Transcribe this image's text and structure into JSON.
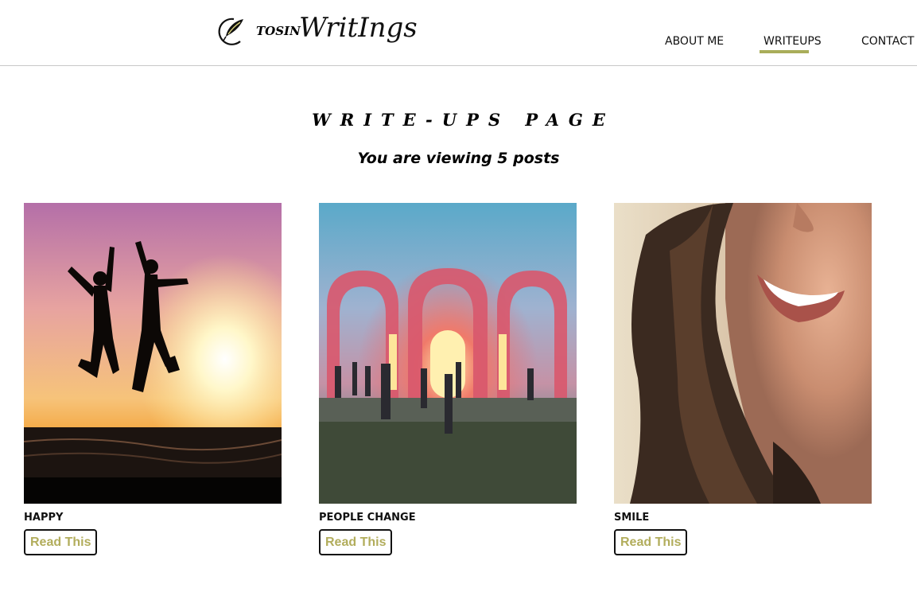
{
  "logo": {
    "name": "TOSIN",
    "script_text": "WritIngs",
    "accent": "#a9ad5a"
  },
  "nav": {
    "items": [
      {
        "label": "ABOUT ME",
        "active": false
      },
      {
        "label": "WRITEUPS",
        "active": true
      },
      {
        "label": "CONTACT",
        "active": false
      }
    ]
  },
  "main": {
    "title": "WRITE-UPS PAGE",
    "subtitle": "You are viewing 5 posts"
  },
  "posts": [
    {
      "title": "HAPPY",
      "button_label": "Read This",
      "image": "silhouettes-jumping-sunset-photo"
    },
    {
      "title": "PEOPLE CHANGE",
      "button_label": "Read This",
      "image": "glowing-arches-people-photo"
    },
    {
      "title": "SMILE",
      "button_label": "Read This",
      "image": "smiling-woman-photo"
    }
  ],
  "colors": {
    "button_text": "#b2ad5c",
    "nav_underline": "#a9ad5a"
  }
}
